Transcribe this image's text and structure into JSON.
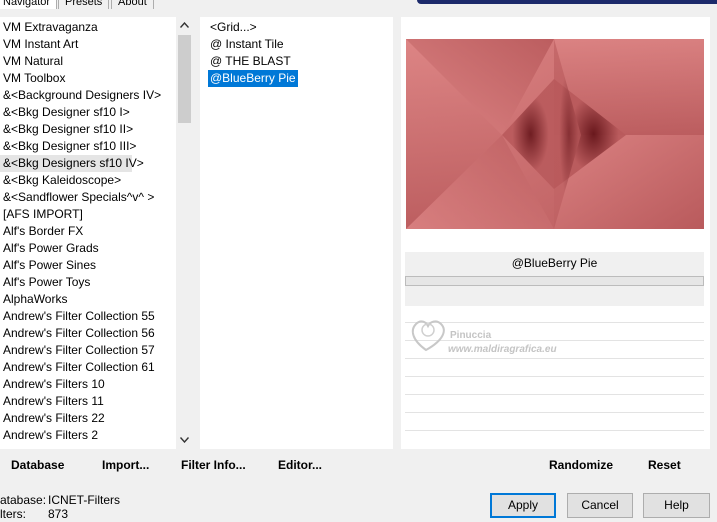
{
  "tabs": [
    {
      "label": "Navigator",
      "active": true
    },
    {
      "label": "Presets",
      "active": false
    },
    {
      "label": "About",
      "active": false
    }
  ],
  "filters": {
    "selected_index": 9,
    "items": [
      "VM Extravaganza",
      "VM Instant Art",
      "VM Natural",
      "VM Toolbox",
      "&<Background Designers IV>",
      "&<Bkg Designer sf10 I>",
      "&<Bkg Designer sf10 II>",
      "&<Bkg Designer sf10 III>",
      "&<Bkg Designers sf10 IV>",
      "&<Bkg Kaleidoscope>",
      "&<Sandflower Specials^v^ >",
      "[AFS IMPORT]",
      "Alf's Border FX",
      "Alf's Power Grads",
      "Alf's Power Sines",
      "Alf's Power Toys",
      "AlphaWorks",
      "Andrew's Filter Collection 55",
      "Andrew's Filter Collection 56",
      "Andrew's Filter Collection 57",
      "Andrew's Filter Collection 61",
      "Andrew's Filters 10",
      "Andrew's Filters 11",
      "Andrew's Filters 22",
      "Andrew's Filters 2"
    ]
  },
  "effects": {
    "selected_index": 3,
    "items": [
      "<Grid...>",
      "@ Instant Tile",
      "@ THE BLAST",
      "@BlueBerry Pie"
    ]
  },
  "preview": {
    "effect_name": "@BlueBerry Pie",
    "progress": 0,
    "colors": {
      "light": "#dd8585",
      "mid": "#b95a5c",
      "dark": "#651419"
    }
  },
  "watermark": {
    "line1": "Pinuccia",
    "line2": "www.maldiragrafica.eu"
  },
  "left_buttons": {
    "database": "Database",
    "import": "Import...",
    "filter_info": "Filter Info...",
    "editor": "Editor..."
  },
  "right_buttons": {
    "randomize": "Randomize",
    "reset": "Reset"
  },
  "status": {
    "database_label": "atabase:",
    "database_value": "ICNET-Filters",
    "filters_label": "lters:",
    "filters_value": "873"
  },
  "dialog_buttons": {
    "apply": "Apply",
    "cancel": "Cancel",
    "help": "Help"
  },
  "icons": {
    "scroll_up": "chevron-up-icon",
    "scroll_down": "chevron-down-icon",
    "watermark_heart": "heart-icon"
  }
}
